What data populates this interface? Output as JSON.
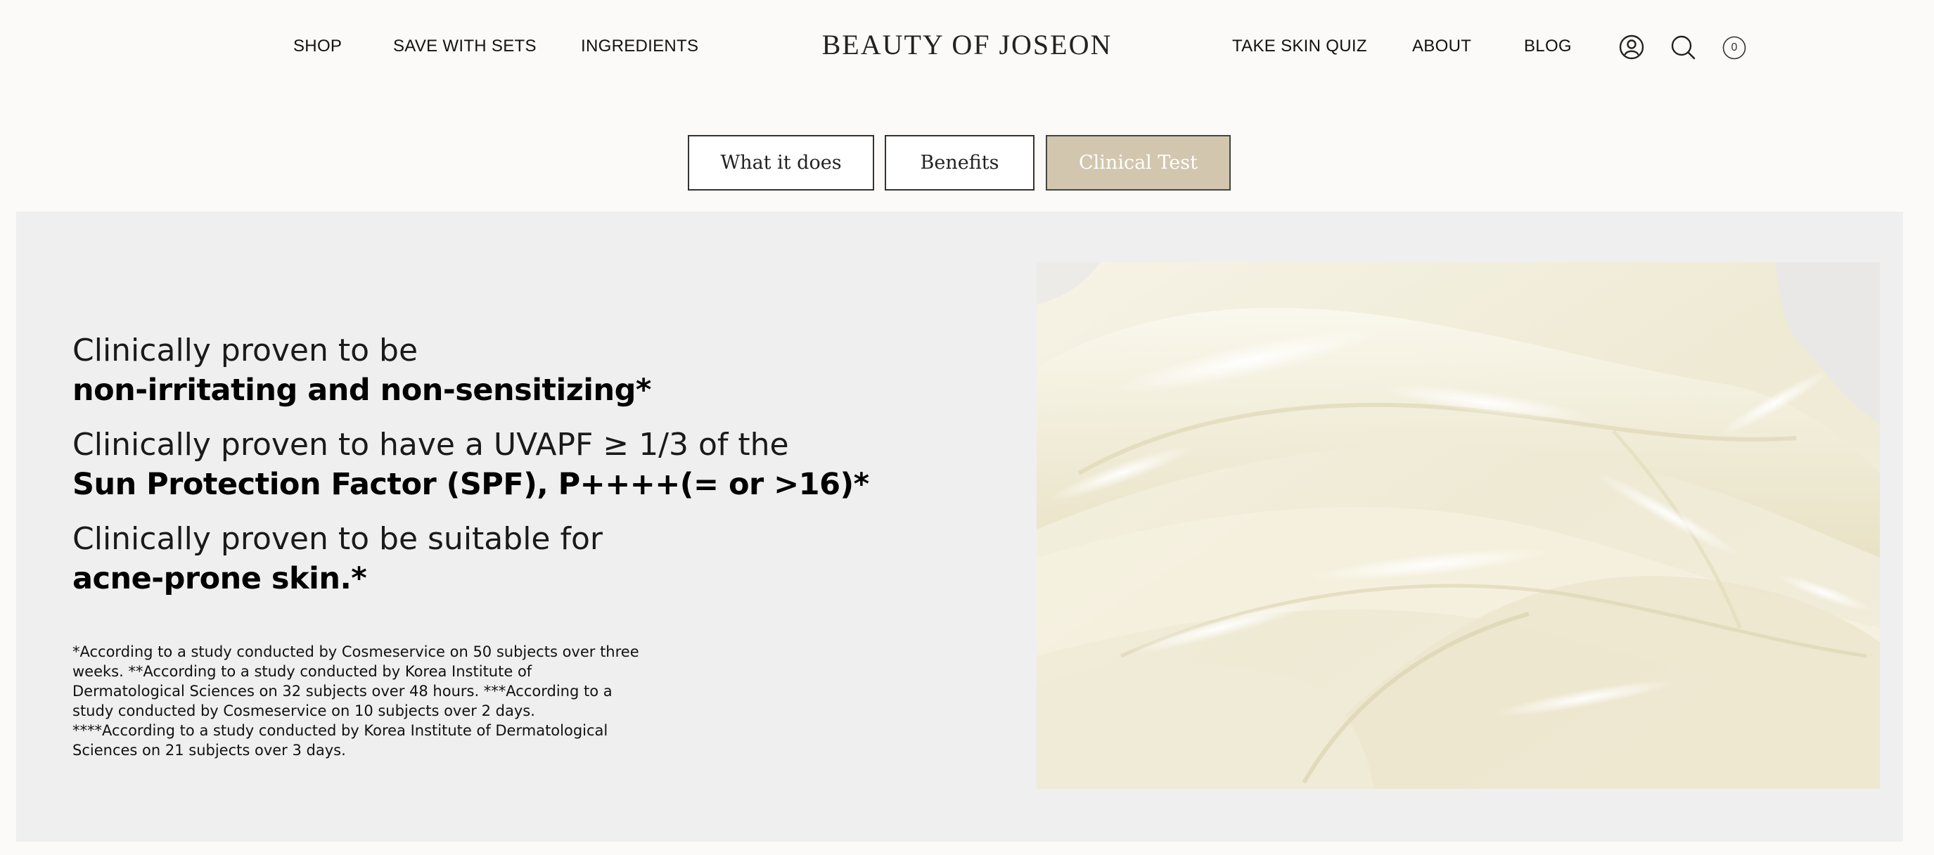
{
  "header": {
    "nav_left": [
      "SHOP",
      "SAVE WITH SETS",
      "INGREDIENTS"
    ],
    "logo": "BEAUTY OF JOSEON",
    "nav_right": [
      "TAKE SKIN QUIZ",
      "ABOUT",
      "BLOG"
    ],
    "icons": [
      "account-icon",
      "search-icon",
      "cart-icon"
    ],
    "cart_count": "0"
  },
  "tabs": [
    {
      "label": "What it does",
      "active": false
    },
    {
      "label": "Benefits",
      "active": false
    },
    {
      "label": "Clinical Test",
      "active": true
    }
  ],
  "content": {
    "claims": [
      {
        "light": "Clinically proven to be",
        "bold": "non-irritating and non-sensitizing*"
      },
      {
        "light": "Clinically proven to have a UVAPF ≥ 1/3 of the",
        "bold": "Sun Protection Factor (SPF), P++++(= or >16)*"
      },
      {
        "light": "Clinically proven to be suitable for",
        "bold": "acne-prone skin.*"
      }
    ],
    "footnote": "*According to a study conducted by Cosmeservice on 50 subjects over three weeks. **According to a study conducted by Korea Institute of Dermatological Sciences on 32 subjects over 48 hours. ***According to a study conducted by Cosmeservice on 10 subjects over 2 days. ****According to a study conducted by Korea Institute of Dermatological Sciences on 21 subjects over 3 days."
  },
  "colors": {
    "page_bg": "#fbfaf8",
    "panel_bg": "#efefef",
    "active_tab_bg": "#d3c6af",
    "cream": "#f3efdd"
  }
}
